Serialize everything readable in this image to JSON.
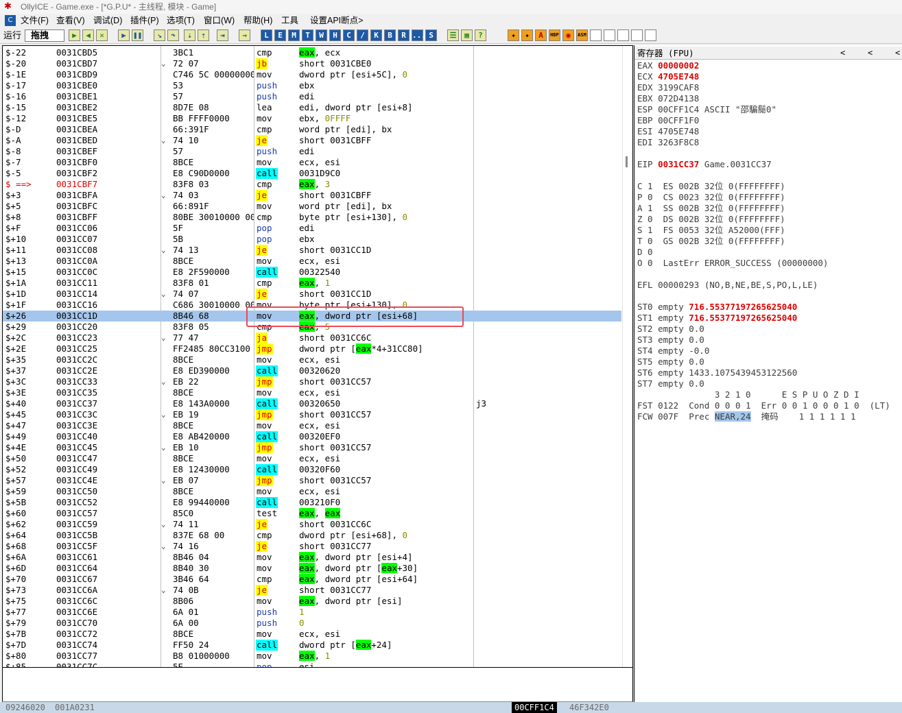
{
  "title": "OllyICE - Game.exe - [*G.P.U* - 主线程, 模块 - Game]",
  "menu": [
    "文件(F)",
    "查看(V)",
    "调试(D)",
    "插件(P)",
    "选项(T)",
    "窗口(W)",
    "帮助(H)",
    "工具",
    "设置API断点>"
  ],
  "toolbar": {
    "run_label": "运行",
    "status": "拖拽",
    "letter_buttons": [
      "L",
      "E",
      "M",
      "T",
      "W",
      "H",
      "C",
      "/",
      "K",
      "B",
      "R",
      "...",
      "S"
    ],
    "plugin_buttons": [
      "HBP",
      "ASM"
    ]
  },
  "disasm": {
    "rows": [
      {
        "rel": "$-22",
        "addr": "0031CBD5",
        "hex": "3BC1",
        "mn": "cmp",
        "op": [
          [
            "",
            "",
            ""
          ],
          [
            "g",
            "eax"
          ],
          [
            "",
            ", ecx"
          ]
        ]
      },
      {
        "rel": "$-20",
        "addr": "0031CBD7",
        "hex": "72 07",
        "arrow": "⌄",
        "mn": "jb",
        "mnc": "y",
        "op": [
          [
            "",
            "short 0031CBE0"
          ]
        ]
      },
      {
        "rel": "$-1E",
        "addr": "0031CBD9",
        "hex": "C746 5C 00000000",
        "mn": "mov",
        "op": [
          [
            "",
            "dword ptr [esi+5C], "
          ],
          [
            "n",
            "0"
          ]
        ]
      },
      {
        "rel": "$-17",
        "addr": "0031CBE0",
        "hex": "53",
        "mn": "push",
        "mnc": "push",
        "op": [
          [
            "",
            "ebx"
          ]
        ]
      },
      {
        "rel": "$-16",
        "addr": "0031CBE1",
        "hex": "57",
        "mn": "push",
        "mnc": "push",
        "op": [
          [
            "",
            "edi"
          ]
        ]
      },
      {
        "rel": "$-15",
        "addr": "0031CBE2",
        "hex": "8D7E 08",
        "mn": "lea",
        "op": [
          [
            "",
            "edi, dword ptr [esi+8]"
          ]
        ]
      },
      {
        "rel": "$-12",
        "addr": "0031CBE5",
        "hex": "BB FFFF0000",
        "mn": "mov",
        "op": [
          [
            "",
            "ebx, "
          ],
          [
            "n",
            "0FFFF"
          ]
        ]
      },
      {
        "rel": "$-D",
        "addr": "0031CBEA",
        "hex": "66:391F",
        "mn": "cmp",
        "op": [
          [
            "",
            "word ptr [edi], bx"
          ]
        ]
      },
      {
        "rel": "$-A",
        "addr": "0031CBED",
        "hex": "74 10",
        "arrow": "⌄",
        "mn": "je",
        "mnc": "y",
        "op": [
          [
            "",
            "short 0031CBFF"
          ]
        ]
      },
      {
        "rel": "$-8",
        "addr": "0031CBEF",
        "hex": "57",
        "mn": "push",
        "mnc": "push",
        "op": [
          [
            "",
            "edi"
          ]
        ]
      },
      {
        "rel": "$-7",
        "addr": "0031CBF0",
        "hex": "8BCE",
        "mn": "mov",
        "op": [
          [
            "",
            "ecx, esi"
          ]
        ]
      },
      {
        "rel": "$-5",
        "addr": "0031CBF2",
        "hex": "E8 C90D0000",
        "mn": "call",
        "mnc": "c",
        "op": [
          [
            "ret",
            "0031D9C0"
          ]
        ]
      },
      {
        "rel": "$ ==>",
        "addr": "0031CBF7",
        "cur": true,
        "hex": "83F8 03",
        "mn": "cmp",
        "op": [
          [
            "g",
            "eax"
          ],
          [
            "",
            ", "
          ],
          [
            "n",
            "3"
          ]
        ]
      },
      {
        "rel": "$+3",
        "addr": "0031CBFA",
        "hex": "74 03",
        "arrow": "⌄",
        "mn": "je",
        "mnc": "y",
        "op": [
          [
            "",
            "short 0031CBFF"
          ]
        ]
      },
      {
        "rel": "$+5",
        "addr": "0031CBFC",
        "hex": "66:891F",
        "mn": "mov",
        "op": [
          [
            "",
            "word ptr [edi], bx"
          ]
        ]
      },
      {
        "rel": "$+8",
        "addr": "0031CBFF",
        "hex": "80BE 30010000 00",
        "mn": "cmp",
        "op": [
          [
            "",
            "byte ptr [esi+130], "
          ],
          [
            "n",
            "0"
          ]
        ]
      },
      {
        "rel": "$+F",
        "addr": "0031CC06",
        "hex": "5F",
        "mn": "pop",
        "mnc": "push",
        "op": [
          [
            "",
            "edi"
          ]
        ]
      },
      {
        "rel": "$+10",
        "addr": "0031CC07",
        "hex": "5B",
        "mn": "pop",
        "mnc": "push",
        "op": [
          [
            "",
            "ebx"
          ]
        ]
      },
      {
        "rel": "$+11",
        "addr": "0031CC08",
        "hex": "74 13",
        "arrow": "⌄",
        "mn": "je",
        "mnc": "y",
        "op": [
          [
            "",
            "short 0031CC1D"
          ]
        ]
      },
      {
        "rel": "$+13",
        "addr": "0031CC0A",
        "hex": "8BCE",
        "mn": "mov",
        "op": [
          [
            "",
            "ecx, esi"
          ]
        ]
      },
      {
        "rel": "$+15",
        "addr": "0031CC0C",
        "hex": "E8 2F590000",
        "mn": "call",
        "mnc": "c",
        "op": [
          [
            "ret",
            "00322540"
          ]
        ]
      },
      {
        "rel": "$+1A",
        "addr": "0031CC11",
        "hex": "83F8 01",
        "mn": "cmp",
        "op": [
          [
            "g",
            "eax"
          ],
          [
            "",
            ", "
          ],
          [
            "n",
            "1"
          ]
        ]
      },
      {
        "rel": "$+1D",
        "addr": "0031CC14",
        "hex": "74 07",
        "arrow": "⌄",
        "mn": "je",
        "mnc": "y",
        "op": [
          [
            "",
            "short 0031CC1D"
          ]
        ]
      },
      {
        "rel": "$+1F",
        "addr": "0031CC16",
        "hex": "C686 30010000 00",
        "mn": "mov",
        "op": [
          [
            "",
            "byte ptr [esi+130], "
          ],
          [
            "n",
            "0"
          ]
        ]
      },
      {
        "rel": "$+26",
        "addr": "0031CC1D",
        "sel": true,
        "hex": "8B46 68",
        "mn": "mov",
        "op": [
          [
            "g",
            "eax"
          ],
          [
            "",
            ", dword ptr [esi+68]"
          ]
        ]
      },
      {
        "rel": "$+29",
        "addr": "0031CC20",
        "hex": "83F8 05",
        "mn": "cmp",
        "op": [
          [
            "g",
            "eax"
          ],
          [
            "",
            ", "
          ],
          [
            "n",
            "5"
          ]
        ]
      },
      {
        "rel": "$+2C",
        "addr": "0031CC23",
        "hex": "77 47",
        "arrow": "⌄",
        "mn": "ja",
        "mnc": "y",
        "op": [
          [
            "",
            "short 0031CC6C"
          ]
        ]
      },
      {
        "rel": "$+2E",
        "addr": "0031CC25",
        "hex": "FF2485 80CC3100",
        "mn": "jmp",
        "mnc": "y",
        "op": [
          [
            "",
            "dword ptr ["
          ],
          [
            "g",
            "eax"
          ],
          [
            "",
            "*4+31CC80]"
          ]
        ]
      },
      {
        "rel": "$+35",
        "addr": "0031CC2C",
        "hex": "8BCE",
        "mn": "mov",
        "op": [
          [
            "",
            "ecx, esi"
          ]
        ]
      },
      {
        "rel": "$+37",
        "addr": "0031CC2E",
        "hex": "E8 ED390000",
        "mn": "call",
        "mnc": "c",
        "op": [
          [
            "ret",
            "00320620"
          ]
        ]
      },
      {
        "rel": "$+3C",
        "addr": "0031CC33",
        "hex": "EB 22",
        "arrow": "⌄",
        "mn": "jmp",
        "mnc": "y",
        "op": [
          [
            "",
            "short 0031CC57"
          ]
        ]
      },
      {
        "rel": "$+3E",
        "addr": "0031CC35",
        "hex": "8BCE",
        "mn": "mov",
        "op": [
          [
            "",
            "ecx, esi"
          ]
        ]
      },
      {
        "rel": "$+40",
        "addr": "0031CC37",
        "hex": "E8 143A0000",
        "mn": "call",
        "mnc": "c",
        "op": [
          [
            "ret",
            "00320650"
          ]
        ],
        "cm": "j3"
      },
      {
        "rel": "$+45",
        "addr": "0031CC3C",
        "hex": "EB 19",
        "arrow": "⌄",
        "mn": "jmp",
        "mnc": "y",
        "op": [
          [
            "",
            "short 0031CC57"
          ]
        ]
      },
      {
        "rel": "$+47",
        "addr": "0031CC3E",
        "hex": "8BCE",
        "mn": "mov",
        "op": [
          [
            "",
            "ecx, esi"
          ]
        ]
      },
      {
        "rel": "$+49",
        "addr": "0031CC40",
        "hex": "E8 AB420000",
        "mn": "call",
        "mnc": "c",
        "op": [
          [
            "ret",
            "00320EF0"
          ]
        ]
      },
      {
        "rel": "$+4E",
        "addr": "0031CC45",
        "hex": "EB 10",
        "arrow": "⌄",
        "mn": "jmp",
        "mnc": "y",
        "op": [
          [
            "",
            "short 0031CC57"
          ]
        ]
      },
      {
        "rel": "$+50",
        "addr": "0031CC47",
        "hex": "8BCE",
        "mn": "mov",
        "op": [
          [
            "",
            "ecx, esi"
          ]
        ]
      },
      {
        "rel": "$+52",
        "addr": "0031CC49",
        "hex": "E8 12430000",
        "mn": "call",
        "mnc": "c",
        "op": [
          [
            "ret",
            "00320F60"
          ]
        ]
      },
      {
        "rel": "$+57",
        "addr": "0031CC4E",
        "hex": "EB 07",
        "arrow": "⌄",
        "mn": "jmp",
        "mnc": "y",
        "op": [
          [
            "",
            "short 0031CC57"
          ]
        ]
      },
      {
        "rel": "$+59",
        "addr": "0031CC50",
        "hex": "8BCE",
        "mn": "mov",
        "op": [
          [
            "",
            "ecx, esi"
          ]
        ]
      },
      {
        "rel": "$+5B",
        "addr": "0031CC52",
        "hex": "E8 99440000",
        "mn": "call",
        "mnc": "c",
        "op": [
          [
            "ret",
            "003210F0"
          ]
        ]
      },
      {
        "rel": "$+60",
        "addr": "0031CC57",
        "hex": "85C0",
        "mn": "test",
        "op": [
          [
            "g",
            "eax"
          ],
          [
            "",
            ", "
          ],
          [
            "g",
            "eax"
          ]
        ]
      },
      {
        "rel": "$+62",
        "addr": "0031CC59",
        "hex": "74 11",
        "arrow": "⌄",
        "mn": "je",
        "mnc": "y",
        "op": [
          [
            "",
            "short 0031CC6C"
          ]
        ]
      },
      {
        "rel": "$+64",
        "addr": "0031CC5B",
        "hex": "837E 68 00",
        "mn": "cmp",
        "op": [
          [
            "",
            "dword ptr [esi+68], "
          ],
          [
            "n",
            "0"
          ]
        ]
      },
      {
        "rel": "$+68",
        "addr": "0031CC5F",
        "hex": "74 16",
        "arrow": "⌄",
        "mn": "je",
        "mnc": "y",
        "op": [
          [
            "",
            "short 0031CC77"
          ]
        ]
      },
      {
        "rel": "$+6A",
        "addr": "0031CC61",
        "hex": "8B46 04",
        "mn": "mov",
        "op": [
          [
            "g",
            "eax"
          ],
          [
            "",
            ", dword ptr [esi+4]"
          ]
        ]
      },
      {
        "rel": "$+6D",
        "addr": "0031CC64",
        "hex": "8B40 30",
        "mn": "mov",
        "op": [
          [
            "g",
            "eax"
          ],
          [
            "",
            ", dword ptr ["
          ],
          [
            "g",
            "eax"
          ],
          [
            "",
            "+30]"
          ]
        ]
      },
      {
        "rel": "$+70",
        "addr": "0031CC67",
        "hex": "3B46 64",
        "mn": "cmp",
        "op": [
          [
            "g",
            "eax"
          ],
          [
            "",
            ", dword ptr [esi+64]"
          ]
        ]
      },
      {
        "rel": "$+73",
        "addr": "0031CC6A",
        "hex": "74 0B",
        "arrow": "⌄",
        "mn": "je",
        "mnc": "y",
        "op": [
          [
            "",
            "short 0031CC77"
          ]
        ]
      },
      {
        "rel": "$+75",
        "addr": "0031CC6C",
        "hex": "8B06",
        "mn": "mov",
        "op": [
          [
            "g",
            "eax"
          ],
          [
            "",
            ", dword ptr [esi]"
          ]
        ]
      },
      {
        "rel": "$+77",
        "addr": "0031CC6E",
        "hex": "6A 01",
        "mn": "push",
        "mnc": "push",
        "op": [
          [
            "n",
            "1"
          ]
        ]
      },
      {
        "rel": "$+79",
        "addr": "0031CC70",
        "hex": "6A 00",
        "mn": "push",
        "mnc": "push",
        "op": [
          [
            "n",
            "0"
          ]
        ]
      },
      {
        "rel": "$+7B",
        "addr": "0031CC72",
        "hex": "8BCE",
        "mn": "mov",
        "op": [
          [
            "",
            "ecx, esi"
          ]
        ]
      },
      {
        "rel": "$+7D",
        "addr": "0031CC74",
        "hex": "FF50 24",
        "mn": "call",
        "mnc": "c",
        "op": [
          [
            "",
            "dword ptr ["
          ],
          [
            "g",
            "eax"
          ],
          [
            "",
            "+24]"
          ]
        ]
      },
      {
        "rel": "$+80",
        "addr": "0031CC77",
        "hex": "B8 01000000",
        "mn": "mov",
        "op": [
          [
            "g",
            "eax"
          ],
          [
            "",
            ", "
          ],
          [
            "n",
            "1"
          ]
        ]
      },
      {
        "rel": "$+85",
        "addr": "0031CC7C",
        "hex": "5E",
        "mn": "pop",
        "mnc": "push",
        "op": [
          [
            "",
            "esi"
          ]
        ]
      }
    ]
  },
  "registers": {
    "header": "寄存器 (FPU)",
    "nav": [
      "<",
      "<",
      "<"
    ],
    "lines": [
      {
        "t": [
          [
            "",
            "EAX "
          ],
          [
            "red",
            "00000002"
          ]
        ]
      },
      {
        "t": [
          [
            "",
            "ECX "
          ],
          [
            "red",
            "4705E748"
          ]
        ]
      },
      {
        "t": [
          [
            "",
            "EDX 3199CAF8"
          ]
        ]
      },
      {
        "t": [
          [
            "",
            "EBX 072D4138"
          ]
        ]
      },
      {
        "t": [
          [
            "",
            "ESP 00CFF1C4 ASCII \"邵騙鬜0\""
          ]
        ]
      },
      {
        "t": [
          [
            "",
            "EBP 00CFF1F0"
          ]
        ]
      },
      {
        "t": [
          [
            "",
            "ESI 4705E748"
          ]
        ]
      },
      {
        "t": [
          [
            "",
            "EDI 3263F8C8"
          ]
        ]
      },
      {
        "t": [
          [
            "",
            ""
          ]
        ]
      },
      {
        "t": [
          [
            "",
            "EIP "
          ],
          [
            "red",
            "0031CC37"
          ],
          [
            "",
            " Game.0031CC37"
          ]
        ]
      },
      {
        "t": [
          [
            "",
            ""
          ]
        ]
      },
      {
        "t": [
          [
            "",
            "C 1  ES 002B 32位 0(FFFFFFFF)"
          ]
        ]
      },
      {
        "t": [
          [
            "",
            "P 0  CS 0023 32位 0(FFFFFFFF)"
          ]
        ]
      },
      {
        "t": [
          [
            "",
            "A 1  SS 002B 32位 0(FFFFFFFF)"
          ]
        ]
      },
      {
        "t": [
          [
            "",
            "Z 0  DS 002B 32位 0(FFFFFFFF)"
          ]
        ]
      },
      {
        "t": [
          [
            "",
            "S 1  FS 0053 32位 A52000(FFF)"
          ]
        ]
      },
      {
        "t": [
          [
            "",
            "T 0  GS 002B 32位 0(FFFFFFFF)"
          ]
        ]
      },
      {
        "t": [
          [
            "",
            "D 0"
          ]
        ]
      },
      {
        "t": [
          [
            "",
            "O 0  LastErr ERROR_SUCCESS (00000000)"
          ]
        ]
      },
      {
        "t": [
          [
            "",
            ""
          ]
        ]
      },
      {
        "t": [
          [
            "",
            "EFL 00000293 (NO,B,NE,BE,S,PO,L,LE)"
          ]
        ]
      },
      {
        "t": [
          [
            "",
            ""
          ]
        ]
      },
      {
        "t": [
          [
            "",
            "ST0 empty "
          ],
          [
            "red",
            "716.5537719726562504"
          ],
          [
            "red",
            "0"
          ]
        ]
      },
      {
        "t": [
          [
            "",
            "ST1 empty "
          ],
          [
            "red",
            "716.5537719726562504"
          ],
          [
            "red",
            "0"
          ]
        ]
      },
      {
        "t": [
          [
            "",
            "ST2 empty 0.0"
          ]
        ]
      },
      {
        "t": [
          [
            "",
            "ST3 empty 0.0"
          ]
        ]
      },
      {
        "t": [
          [
            "",
            "ST4 empty -0.0"
          ]
        ]
      },
      {
        "t": [
          [
            "",
            "ST5 empty 0.0"
          ]
        ]
      },
      {
        "t": [
          [
            "",
            "ST6 empty 1433.1075439453122560"
          ]
        ]
      },
      {
        "t": [
          [
            "",
            "ST7 empty 0.0"
          ]
        ]
      },
      {
        "t": [
          [
            "",
            "               3 2 1 0      E S P U O Z D I"
          ]
        ]
      },
      {
        "t": [
          [
            "",
            "FST 0122  Cond 0 0 0 1  Err 0 0 1 0 0 0 1 0  (LT)"
          ]
        ]
      },
      {
        "t": [
          [
            "",
            "FCW 007F  Prec "
          ],
          [
            "blu",
            "NEAR,24"
          ],
          [
            "",
            "  掩码    1 1 1 1 1 1"
          ]
        ]
      }
    ]
  },
  "statusbar": {
    "left1": "09246020",
    "left2": "001A0231",
    "mid": "00CFF1C4",
    "right": "46F342E0"
  }
}
